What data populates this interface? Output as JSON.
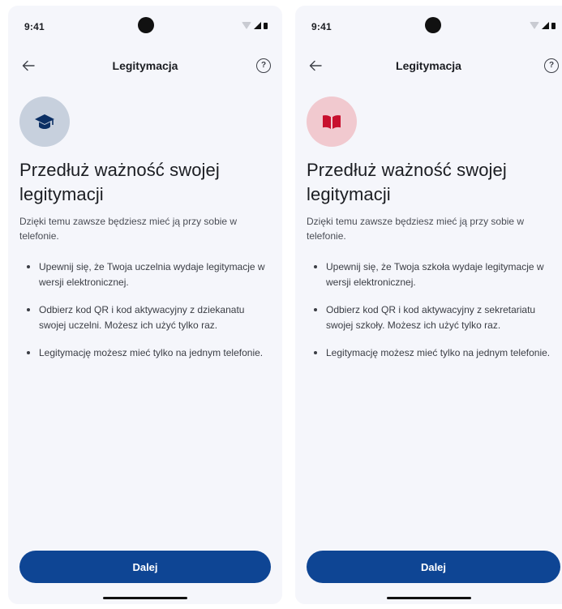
{
  "screens": [
    {
      "status": {
        "time": "9:41"
      },
      "app_bar": {
        "title": "Legitymacja",
        "help_symbol": "?"
      },
      "badge": {
        "icon": "graduation-cap-icon",
        "bg_color": "#c7d0dd",
        "icon_color": "#0b2f64"
      },
      "headline": "Przedłuż ważność swojej legitymacji",
      "lead": "Dzięki temu zawsze będziesz mieć ją przy sobie w telefonie.",
      "bullets": [
        "Upewnij się, że Twoja uczelnia wydaje legitymacje w wersji elektronicznej.",
        "Odbierz kod QR i kod aktywacyjny z dziekanatu swojej uczelni. Możesz ich użyć tylko raz.",
        "Legitymację możesz mieć tylko na jednym telefonie."
      ],
      "primary_button": "Dalej"
    },
    {
      "status": {
        "time": "9:41"
      },
      "app_bar": {
        "title": "Legitymacja",
        "help_symbol": "?"
      },
      "badge": {
        "icon": "open-book-icon",
        "bg_color": "#f1c9cf",
        "icon_color": "#c8102e"
      },
      "headline": "Przedłuż ważność swojej legitymacji",
      "lead": "Dzięki temu zawsze będziesz mieć ją przy sobie w telefonie.",
      "bullets": [
        "Upewnij się, że Twoja szkoła wydaje legitymacje w wersji elektronicznej.",
        "Odbierz kod QR i kod aktywacyjny z sekretariatu swojej szkoły. Możesz ich użyć tylko raz.",
        "Legitymację możesz mieć tylko na jednym telefonie."
      ],
      "primary_button": "Dalej"
    }
  ],
  "colors": {
    "accent": "#0e4594",
    "surface": "#f5f6fb"
  }
}
